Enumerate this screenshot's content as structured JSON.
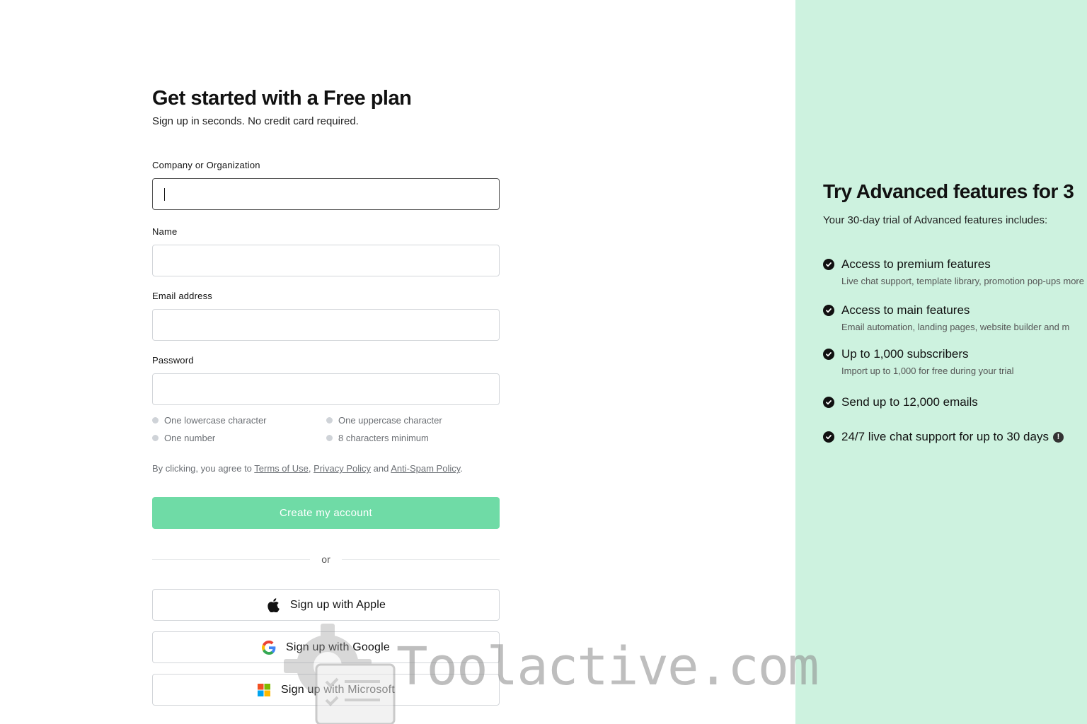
{
  "form": {
    "title": "Get started with a Free plan",
    "subtitle": "Sign up in seconds. No credit card required.",
    "fields": {
      "company": {
        "label": "Company or Organization",
        "value": ""
      },
      "name": {
        "label": "Name",
        "value": ""
      },
      "email": {
        "label": "Email address",
        "value": ""
      },
      "password": {
        "label": "Password",
        "value": ""
      }
    },
    "password_rules": [
      "One lowercase character",
      "One uppercase character",
      "One number",
      "8 characters minimum"
    ],
    "terms": {
      "prefix": "By clicking, you agree to ",
      "terms_link": "Terms of Use",
      "sep": ",",
      "privacy_link": "Privacy Policy",
      "and": " and ",
      "antispam_link": "Anti-Spam Policy",
      "suffix": "."
    },
    "create_button": "Create my account",
    "or_text": "or",
    "social": {
      "apple": "Sign up with Apple",
      "google": "Sign up with Google",
      "microsoft": "Sign up with Microsoft"
    }
  },
  "panel": {
    "title": "Try Advanced features for 3",
    "subtitle": "Your 30-day trial of Advanced features includes:",
    "features": [
      {
        "title": "Access to premium features",
        "desc": "Live chat support, template library, promotion pop-ups more"
      },
      {
        "title": "Access to main features",
        "desc": "Email automation, landing pages, website builder and m"
      },
      {
        "title": "Up to 1,000 subscribers",
        "desc": "Import up to 1,000 for free during your trial"
      },
      {
        "title": "Send up to 12,000 emails",
        "desc": ""
      },
      {
        "title": "24/7 live chat support for up to 30 days",
        "desc": ""
      }
    ],
    "info_symbol": "!"
  },
  "watermark": {
    "text": "Toolactive.com"
  },
  "colors": {
    "accent": "#6fdba6",
    "panel_bg": "#cdf2df"
  },
  "icons": {
    "apple": "apple-icon",
    "google": "google-icon",
    "microsoft": "microsoft-icon",
    "check": "check-circle-icon",
    "info": "info-icon"
  }
}
